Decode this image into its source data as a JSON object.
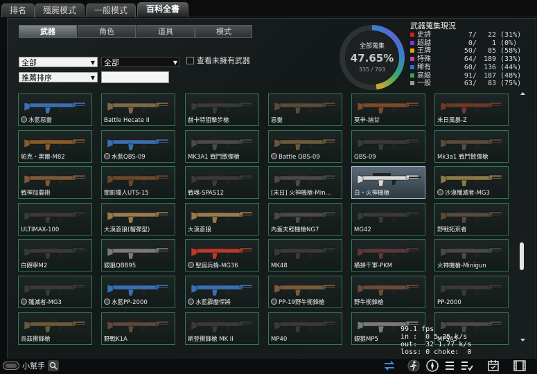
{
  "top_tabs": [
    {
      "label": "排名",
      "active": false
    },
    {
      "label": "殭屍模式",
      "active": false
    },
    {
      "label": "一般模式",
      "active": false
    },
    {
      "label": "百科全書",
      "active": true
    }
  ],
  "sub_tabs": [
    {
      "label": "武器",
      "active": true
    },
    {
      "label": "角色",
      "active": false
    },
    {
      "label": "道具",
      "active": false
    },
    {
      "label": "模式",
      "active": false
    }
  ],
  "filters": {
    "filter1": "全部",
    "filter2": "全部",
    "sort": "推薦排序",
    "search_value": "",
    "show_unowned_label": "查看未擁有武器"
  },
  "collection": {
    "title": "全部蒐集",
    "percent": "47.65%",
    "fraction": "335 / 703",
    "fill_fraction": 0.4765
  },
  "stats": {
    "title": "武器蒐集現況",
    "rows": [
      {
        "name": "史詩",
        "count": "7/",
        "total": "22",
        "pct": "(31%)",
        "color": "#d21f1f"
      },
      {
        "name": "超越",
        "count": "0/",
        "total": "1",
        "pct": "(0%)",
        "color": "#8a2be2"
      },
      {
        "name": "王牌",
        "count": "50/",
        "total": "85",
        "pct": "(58%)",
        "color": "#e0a31a"
      },
      {
        "name": "特殊",
        "count": "64/",
        "total": "189",
        "pct": "(33%)",
        "color": "#c93ab8"
      },
      {
        "name": "稀有",
        "count": "60/",
        "total": "136",
        "pct": "(44%)",
        "color": "#2f6fd6"
      },
      {
        "name": "高級",
        "count": "91/",
        "total": "187",
        "pct": "(48%)",
        "color": "#2fa84f"
      },
      {
        "name": "一般",
        "count": "63/",
        "total": "83",
        "pct": "(75%)",
        "color": "#9a9a9a"
      }
    ]
  },
  "weapons": [
    {
      "name": "水藍惡靈",
      "medal": true,
      "color": "#3a6fb0"
    },
    {
      "name": "Battle Hecate II",
      "medal": false,
      "color": "#7a6a4a"
    },
    {
      "name": "赫卡特狙擊步槍",
      "medal": false,
      "color": "#3a3a3a"
    },
    {
      "name": "惡靈",
      "medal": false,
      "color": "#5a4a3a"
    },
    {
      "name": "莫辛-納甘",
      "medal": false,
      "color": "#7a4a2a"
    },
    {
      "name": "末日風暴-Z",
      "medal": false,
      "color": "#6a3a2a"
    },
    {
      "name": "帕克・黑爾-M82",
      "medal": false,
      "color": "#8a5a2a"
    },
    {
      "name": "水藍QBS-09",
      "medal": true,
      "color": "#3a6fb0"
    },
    {
      "name": "MK3A1 戰鬥散彈槍",
      "medal": false,
      "color": "#4a4a4a"
    },
    {
      "name": "Battle QBS-09",
      "medal": true,
      "color": "#6a5a3a"
    },
    {
      "name": "QBS-09",
      "medal": false,
      "color": "#3a3a3a"
    },
    {
      "name": "Mk3a1 戰鬥散彈槍",
      "medal": false,
      "color": "#5a4a3a"
    },
    {
      "name": "戰神加農砲",
      "medal": false,
      "color": "#7a5a3a"
    },
    {
      "name": "闇影獵人UTS-15",
      "medal": false,
      "color": "#6a4a2a"
    },
    {
      "name": "戰魂-SPAS12",
      "medal": false,
      "color": "#3a3a3a"
    },
    {
      "name": "[末日] 火神機槍-Min...",
      "medal": false,
      "color": "#4a4a4a"
    },
    {
      "name": "白・火神機槍",
      "medal": false,
      "color": "#d8d8d8"
    },
    {
      "name": "沙漠殲滅者-MG3",
      "medal": true,
      "color": "#8a7a4a"
    },
    {
      "name": "ULTIMAX-100",
      "medal": false,
      "color": "#3a3a3a"
    },
    {
      "name": "大漠蒼狼(榴彈型)",
      "medal": false,
      "color": "#9a7a4a"
    },
    {
      "name": "大漠蒼狼",
      "medal": false,
      "color": "#9a7a4a"
    },
    {
      "name": "內蓋夫輕機槍NG7",
      "medal": false,
      "color": "#4a4a4a"
    },
    {
      "name": "MG42",
      "medal": false,
      "color": "#3a3a3a"
    },
    {
      "name": "野戰拓荒者",
      "medal": false,
      "color": "#5a4a3a"
    },
    {
      "name": "白朗寧M2",
      "medal": false,
      "color": "#3a3a3a"
    },
    {
      "name": "銀狼QBB95",
      "medal": false,
      "color": "#7a7a7a"
    },
    {
      "name": "聖誕兵蜂-MG36",
      "medal": true,
      "color": "#b83a2a"
    },
    {
      "name": "MK48",
      "medal": false,
      "color": "#3a3a3a"
    },
    {
      "name": "橫掃千軍-PKM",
      "medal": false,
      "color": "#5a3a3a"
    },
    {
      "name": "火神機槍-Minigun",
      "medal": false,
      "color": "#4a4a4a"
    },
    {
      "name": "殲滅者-MG3",
      "medal": true,
      "color": "#3a3a3a"
    },
    {
      "name": "水藍PP-2000",
      "medal": true,
      "color": "#3a6fb0"
    },
    {
      "name": "水藍霹靂悍將",
      "medal": true,
      "color": "#3a6fb0"
    },
    {
      "name": "PP-19野牛衝鋒槍",
      "medal": true,
      "color": "#7a5a3a"
    },
    {
      "name": "野牛衝鋒槍",
      "medal": false,
      "color": "#6a4a3a"
    },
    {
      "name": "PP-2000",
      "medal": false,
      "color": "#3a3a3a"
    },
    {
      "name": "烏茲衝鋒槍",
      "medal": false,
      "color": "#6a5a3a"
    },
    {
      "name": "野戰K1A",
      "medal": false,
      "color": "#5a4a3a"
    },
    {
      "name": "斯登衝鋒槍 MK II",
      "medal": false,
      "color": "#3a3a3a"
    },
    {
      "name": "MP40",
      "medal": false,
      "color": "#3a3a3a"
    },
    {
      "name": "銀狼MP5",
      "medal": false,
      "color": "#7a7a7a"
    },
    {
      "name": "MP5A5",
      "medal": false,
      "color": "#4a4a4a"
    }
  ],
  "selected_weapon_index": 16,
  "net_stats": {
    "fps": "99.1 fps",
    "in": "in :  0 5.25 k/s",
    "out": "out:  32 1.77 k/s",
    "loss": "loss: 0 choke:  0"
  },
  "bottom": {
    "helper_label": "小幫手"
  }
}
